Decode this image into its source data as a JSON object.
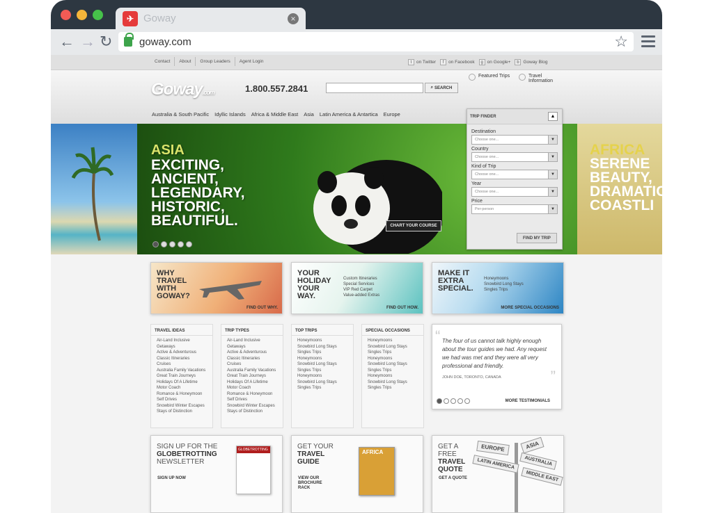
{
  "tab": {
    "title": "Goway"
  },
  "address_bar": {
    "url": "goway.com"
  },
  "top_links": [
    "Contact",
    "About",
    "Group Leaders",
    "Agent Login"
  ],
  "social_links": [
    "on Twitter",
    "on Facebook",
    "on Google+",
    "Goway Blog"
  ],
  "header": {
    "logo": "Goway",
    "logo_sub": ".com",
    "phone": "1.800.557.2841",
    "search_button": "SEARCH",
    "quick_links": [
      "Featured Trips",
      "Travel Information"
    ],
    "regions": [
      "Australia & South Pacific",
      "Idyllic Islands",
      "Africa & Middle East",
      "Asia",
      "Latin America & Antartica",
      "Europe"
    ]
  },
  "hero": {
    "region": "ASIA",
    "lines": [
      "EXCITING,",
      "ANCIENT,",
      "LEGENDARY,",
      "HISTORIC,",
      "BEAUTIFUL."
    ],
    "cta": "CHART YOUR COURSE",
    "right_region": "AFRICA",
    "right_lines": [
      "SERENE",
      "BEAUTY,",
      "DRAMATIC",
      "COASTLI"
    ]
  },
  "trip_finder": {
    "title": "TRIP FINDER",
    "fields": [
      {
        "label": "Destination",
        "value": "Choose one..."
      },
      {
        "label": "Country",
        "value": "Choose one..."
      },
      {
        "label": "Kind of Trip",
        "value": "Choose one..."
      },
      {
        "label": "Year",
        "value": "Choose one..."
      },
      {
        "label": "Price",
        "value": "Per-person"
      }
    ],
    "button": "FIND MY TRIP"
  },
  "promos": [
    {
      "heading": "WHY TRAVEL WITH GOWAY?",
      "items": [],
      "more": "FIND OUT WHY."
    },
    {
      "heading": "YOUR HOLIDAY YOUR WAY.",
      "items": [
        "Custom Itineraries",
        "Special Services",
        "VIP Red Carpet",
        "Value-added Extras"
      ],
      "more": "FIND OUT HOW."
    },
    {
      "heading": "MAKE IT EXTRA SPECIAL.",
      "items": [
        "Honeymoons",
        "Snowbird Long Stays",
        "Singles Trips"
      ],
      "more": "MORE SPECIAL OCCASIONS"
    }
  ],
  "columns": [
    {
      "title": "TRAVEL IDEAS",
      "items": [
        "Air-Land Inclusive Getaways",
        "Active & Adventurous",
        "Classic Itineraries",
        "Cruises",
        "Australia Family Vacations",
        "Great Train Journeys",
        "Holidays Of A Lifetime",
        "Motor Coach",
        "Romance & Honeymoon",
        "Self Drives",
        "Snowbird Winter Escapes",
        "Stays of Distinction"
      ]
    },
    {
      "title": "TRIP TYPES",
      "items": [
        "Air-Land Inclusive Getaways",
        "Active & Adventurous",
        "Classic Itineraries",
        "Cruises",
        "Australia Family Vacations",
        "Great Train Journeys",
        "Holidays Of A Lifetime",
        "Motor Coach",
        "Romance & Honeymoon",
        "Self Drives",
        "Snowbird Winter Escapes",
        "Stays of Distinction"
      ]
    },
    {
      "title": "TOP TRIPS",
      "items": [
        "Honeymoons",
        "Snowbird Long Stays",
        "Singles Trips",
        "Honeymoons",
        "Snowbird Long Stays",
        "Singles Trips",
        "Honeymoons",
        "Snowbird Long Stays",
        "Singles Trips"
      ]
    },
    {
      "title": "SPECIAL OCCASIONS",
      "items": [
        "Honeymoons",
        "Snowbird Long Stays",
        "Singles Trips",
        "Honeymoons",
        "Snowbird Long Stays",
        "Singles Trips",
        "Honeymoons",
        "Snowbird Long Stays",
        "Singles Trips"
      ]
    }
  ],
  "testimonial": {
    "quote": "The four of us cannot talk highly enough about the tour guides we had. Any request we had was met and they were all very professional and friendly.",
    "author": "JOHN DOE, TORONTO, CANADA",
    "more": "MORE TESTIMONIALS"
  },
  "bottom_cards": [
    {
      "line1": "SIGN UP FOR THE",
      "line2": "GLOBETROTTING",
      "line3": "NEWSLETTER",
      "cta": "SIGN UP NOW",
      "image_title": "GLOBETROTTING"
    },
    {
      "line1": "GET YOUR",
      "line2": "TRAVEL",
      "line3": "GUIDE",
      "cta": "VIEW OUR BROCHURE RACK",
      "image_title": "AFRICA"
    },
    {
      "line1": "GET A FREE",
      "line2": "TRAVEL",
      "line3": "QUOTE",
      "cta": "GET A QUOTE",
      "signs": [
        "EUROPE",
        "ASIA",
        "LATIN AMERICA",
        "AUSTRALIA",
        "MIDDLE EAST"
      ]
    }
  ]
}
